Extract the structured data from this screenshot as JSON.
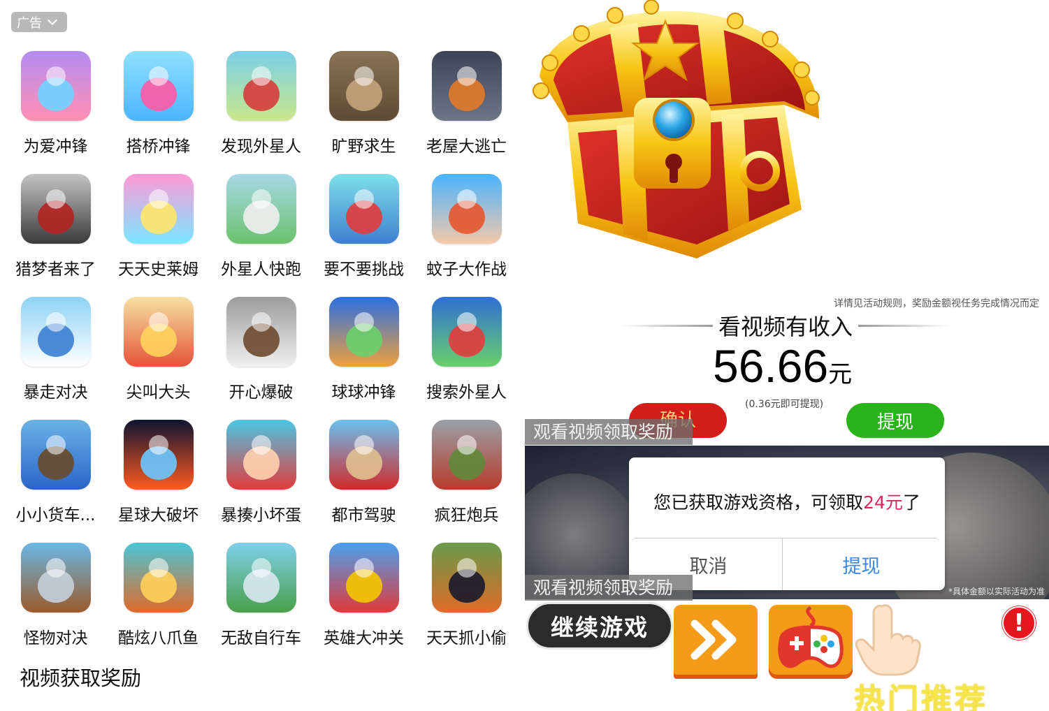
{
  "ad_panel": {
    "ad_tag": "广告",
    "games": [
      {
        "label": "为爱冲锋",
        "icon": "wedding-runner-icon"
      },
      {
        "label": "搭桥冲锋",
        "icon": "bridge-stack-icon"
      },
      {
        "label": "发现外星人",
        "icon": "alien-find-icon"
      },
      {
        "label": "旷野求生",
        "icon": "block-survival-icon"
      },
      {
        "label": "老屋大逃亡",
        "icon": "prison-escape-icon"
      },
      {
        "label": "猎梦者来了",
        "icon": "dream-hunter-icon"
      },
      {
        "label": "天天史莱姆",
        "icon": "slime-icon"
      },
      {
        "label": "外星人快跑",
        "icon": "alien-run-icon"
      },
      {
        "label": "要不要挑战",
        "icon": "choice-girl-icon"
      },
      {
        "label": "蚊子大作战",
        "icon": "mosquito-icon"
      },
      {
        "label": "暴走对决",
        "icon": "stickman-duel-icon"
      },
      {
        "label": "尖叫大头",
        "icon": "scream-head-icon"
      },
      {
        "label": "开心爆破",
        "icon": "tnt-icon"
      },
      {
        "label": "球球冲锋",
        "icon": "ball-track-icon"
      },
      {
        "label": "搜索外星人",
        "icon": "alien-search-icon"
      },
      {
        "label": "小小货车...",
        "icon": "cargo-truck-icon"
      },
      {
        "label": "星球大破坏",
        "icon": "planet-smash-icon"
      },
      {
        "label": "暴揍小坏蛋",
        "icon": "angry-face-icon"
      },
      {
        "label": "都市驾驶",
        "icon": "sports-car-icon"
      },
      {
        "label": "疯狂炮兵",
        "icon": "army-icon"
      },
      {
        "label": "怪物对决",
        "icon": "shark-monster-icon"
      },
      {
        "label": "酷炫八爪鱼",
        "icon": "octopus-icon"
      },
      {
        "label": "无敌自行车",
        "icon": "bicycle-icon"
      },
      {
        "label": "英雄大冲关",
        "icon": "hero-tower-icon"
      },
      {
        "label": "天天抓小偷",
        "icon": "police-chase-icon"
      }
    ],
    "reward_title": "视频获取奖励"
  },
  "reward": {
    "rules_note": "详情见活动规则，奖励金额视任务完成情况而定",
    "heading": "看视频有收入",
    "amount": "56.66",
    "unit": "元",
    "min_note": "(0.36元即可提现)",
    "confirm_label": "确认",
    "withdraw_label": "提现"
  },
  "video": {
    "banner_top": "观看视频领取奖励",
    "banner_bottom": "观看视频领取奖励",
    "fine_print": "*具体金额以实际活动为准"
  },
  "dialog": {
    "message_prefix": "您已获取游戏资格，可领取",
    "message_highlight": "24元",
    "message_suffix": "了",
    "cancel_label": "取消",
    "ok_label": "提现"
  },
  "footer": {
    "continue_label": "继续游戏",
    "hot_label": "热门推荐",
    "alert_symbol": "!"
  },
  "colors": {
    "confirm_red": "#d31d18",
    "withdraw_green": "#2ab31b",
    "highlight_pink": "#e0245e",
    "link_blue": "#3b8ae0",
    "orange_button": "#f49b1a",
    "hot_yellow": "#f5e44a"
  }
}
